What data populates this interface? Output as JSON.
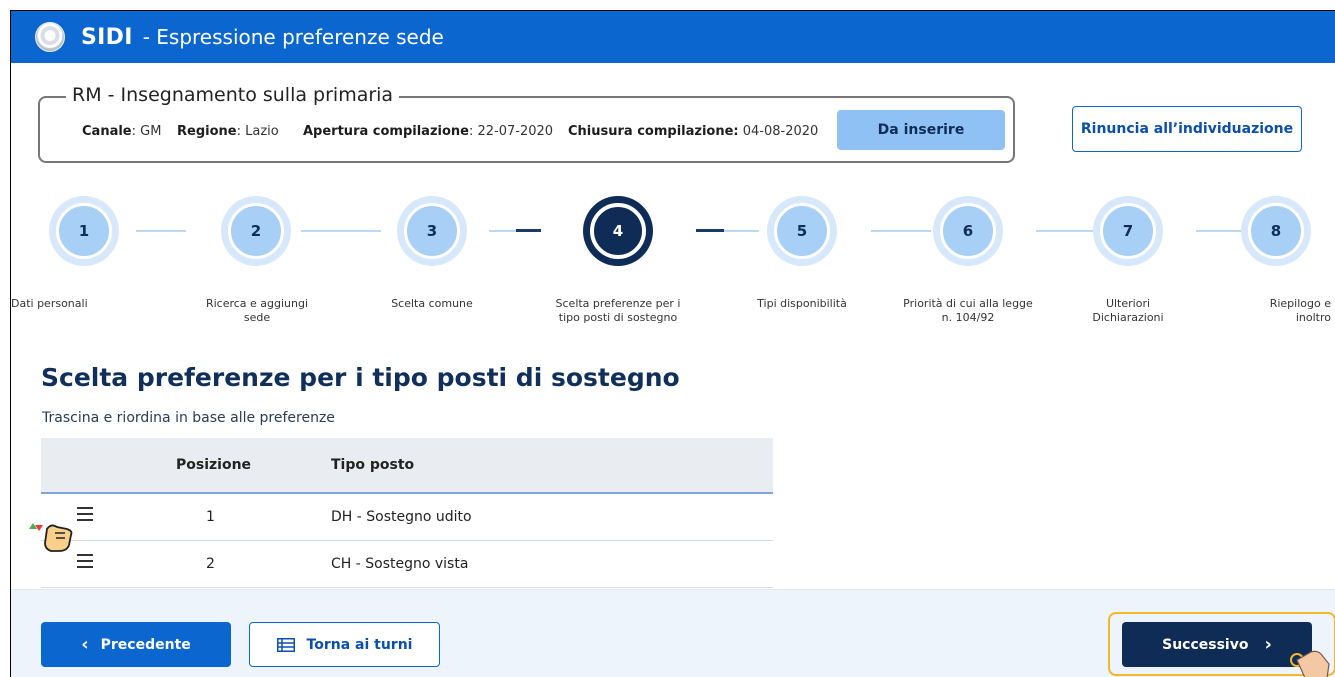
{
  "header": {
    "app_name": "SIDI",
    "page_name": "- Espressione preferenze sede"
  },
  "info": {
    "legend": "RM - Insegnamento sulla primaria",
    "canale_label": "Canale",
    "canale_value": ": GM",
    "regione_label": "Regione",
    "regione_value": ": Lazio",
    "apertura_label": "Apertura compilazione",
    "apertura_value": ": 22-07-2020",
    "chiusura_label": "Chiusura compilazione:",
    "chiusura_value": " 04-08-2020",
    "status": "Da inserire"
  },
  "actions": {
    "rinuncia": "Rinuncia all’individuazione"
  },
  "stepper": {
    "current": 4,
    "steps": [
      {
        "num": "1",
        "label": "Dati personali"
      },
      {
        "num": "2",
        "label": "Ricerca e aggiungi sede"
      },
      {
        "num": "3",
        "label": "Scelta comune"
      },
      {
        "num": "4",
        "label": "Scelta preferenze per i tipo posti di sostegno"
      },
      {
        "num": "5",
        "label": "Tipi disponibilità"
      },
      {
        "num": "6",
        "label": "Priorità di cui alla legge n. 104/92"
      },
      {
        "num": "7",
        "label": "Ulteriori Dichiarazioni"
      },
      {
        "num": "8",
        "label": "Riepilogo e inoltro"
      }
    ]
  },
  "main": {
    "title": "Scelta preferenze per i tipo posti di sostegno",
    "hint": "Trascina e riordina in base alle preferenze",
    "table": {
      "headers": [
        "Posizione",
        "Tipo posto"
      ],
      "rows": [
        {
          "posizione": "1",
          "tipo": "DH - Sostegno udito"
        },
        {
          "posizione": "2",
          "tipo": "CH - Sostegno vista"
        }
      ]
    }
  },
  "footer": {
    "prev": "Precedente",
    "turni": "Torna ai turni",
    "next": "Successivo"
  },
  "colors": {
    "header_blue": "#0b66d0",
    "dark_navy": "#0f2c57",
    "status_pill": "#8fc1f5",
    "highlight": "#f2b72a"
  }
}
